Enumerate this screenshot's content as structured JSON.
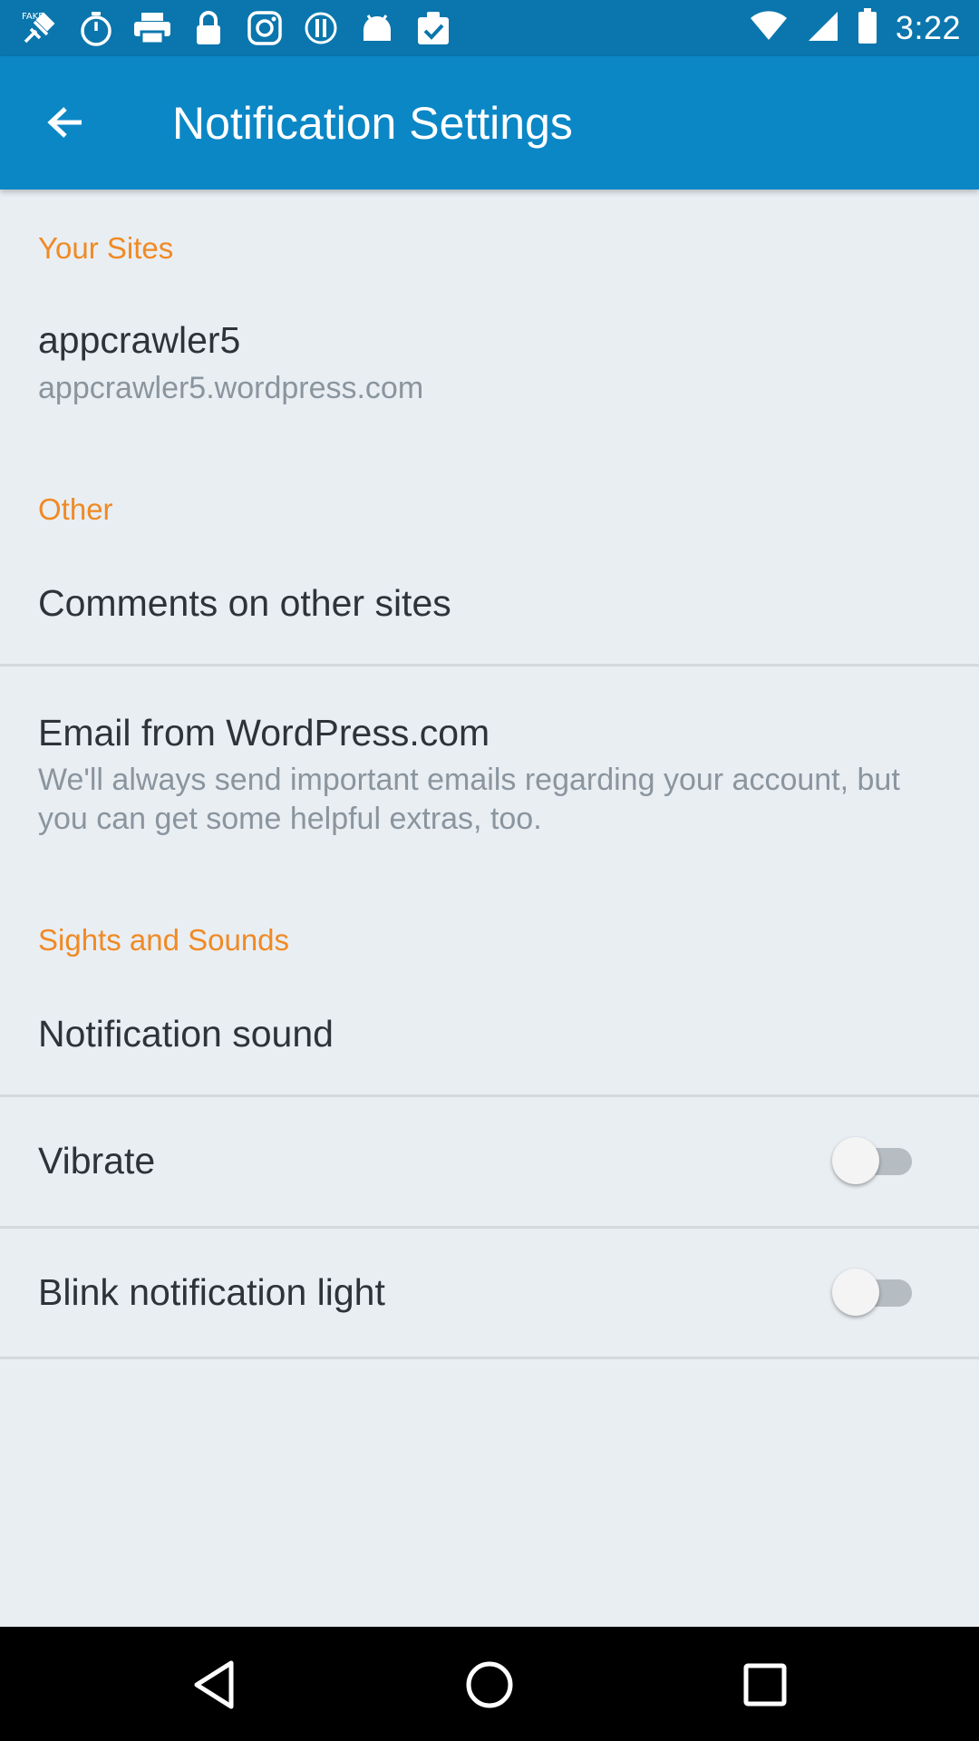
{
  "status_bar": {
    "time": "3:22",
    "icons": [
      "fake-gps-icon",
      "stopwatch-icon",
      "printer-icon",
      "lock-icon",
      "instagram-icon",
      "coin-icon",
      "android-icon",
      "clipboard-check-icon",
      "wifi-icon",
      "signal-icon",
      "battery-icon"
    ]
  },
  "app_bar": {
    "title": "Notification Settings",
    "back_icon": "arrow-back-icon"
  },
  "sections": {
    "your_sites": {
      "header": "Your Sites",
      "site_name": "appcrawler5",
      "site_url": "appcrawler5.wordpress.com"
    },
    "other": {
      "header": "Other",
      "comments_label": "Comments on other sites",
      "email_label": "Email from WordPress.com",
      "email_summary": "We'll always send important emails regarding your account, but you can get some helpful extras, too."
    },
    "sights_sounds": {
      "header": "Sights and Sounds",
      "notification_sound_label": "Notification sound",
      "vibrate_label": "Vibrate",
      "vibrate_on": false,
      "blink_label": "Blink notification light",
      "blink_on": false
    }
  },
  "colors": {
    "status_bar": "#0a76ad",
    "app_bar": "#0b87c6",
    "section_header": "#f08a24",
    "background": "#e9eef3"
  },
  "nav_bar": {
    "icons": [
      "back-triangle-icon",
      "home-circle-icon",
      "recents-square-icon"
    ]
  }
}
